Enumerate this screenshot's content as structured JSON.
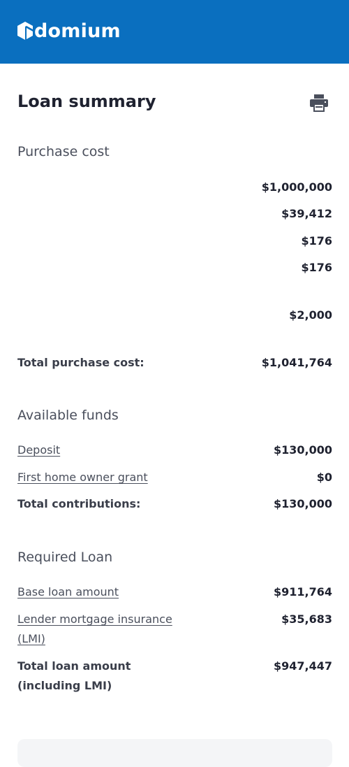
{
  "brand": {
    "name": "domium",
    "color": "#0a6fbf"
  },
  "summary": {
    "title": "Loan summary",
    "print_icon": "print-icon"
  },
  "purchase_cost": {
    "heading": "Purchase cost",
    "amounts": [
      "$1,000,000",
      "$39,412",
      "$176",
      "$176",
      "$2,000"
    ],
    "total_label": "Total purchase cost:",
    "total_value": "$1,041,764"
  },
  "available_funds": {
    "heading": "Available funds",
    "deposit_label": "Deposit",
    "deposit_value": "$130,000",
    "grant_label": "First home owner grant",
    "grant_value": "$0",
    "total_label": "Total contributions:",
    "total_value": "$130,000"
  },
  "required_loan": {
    "heading": "Required Loan",
    "base_label": "Base loan amount",
    "base_value": "$911,764",
    "lmi_label": "Lender mortgage insurance (LMI)",
    "lmi_value": "$35,683",
    "total_label": "Total loan amount (including LMI)",
    "total_value": "$947,447"
  }
}
